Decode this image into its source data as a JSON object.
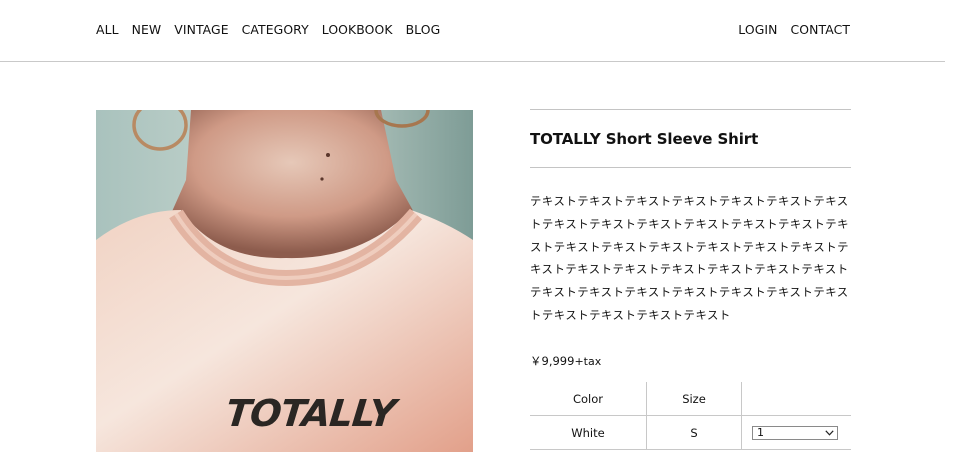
{
  "nav": {
    "left": [
      "ALL",
      "NEW",
      "VINTAGE",
      "CATEGORY",
      "LOOKBOOK",
      "BLOG"
    ],
    "right": [
      "LOGIN",
      "CONTACT"
    ]
  },
  "product": {
    "photo_text": "TOTALLY",
    "title": "TOTALLY Short Sleeve Shirt",
    "description": "テキストテキストテキストテキストテキストテキストテキストテキストテキストテキストテキストテキストテキストテキストテキストテキストテキストテキストテキストテキストテキストテキストテキストテキストテキストテキストテキストテキストテキストテキストテキストテキストテキストテキストテキストテキストテキストテキスト",
    "price": "￥9,999",
    "tax_label": "+tax"
  },
  "options": {
    "headers": [
      "Color",
      "Size",
      ""
    ],
    "color_value": "White",
    "size_value": "S",
    "quantity": "1"
  },
  "colors": {
    "divider": "#c9c9c9",
    "text": "#111111"
  }
}
